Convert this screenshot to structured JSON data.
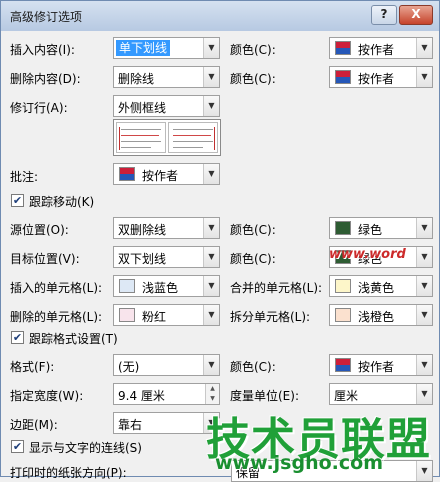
{
  "window": {
    "title": "高级修订选项",
    "help_label": "?",
    "close_label": "X"
  },
  "colors": {
    "author_top": "#cc1f3a",
    "author_bottom": "#2557b8",
    "green": "#2e5c33",
    "light_blue": "#dde8f5",
    "pink": "#f8e4ec",
    "light_orange": "#fbe1cf",
    "selection": "#3399ff"
  },
  "markup": {
    "insert_label": "插入内容(I):",
    "insert_value": "单下划线",
    "insert_color_label": "颜色(C):",
    "insert_color_value": "按作者",
    "delete_label": "删除内容(D):",
    "delete_value": "删除线",
    "delete_color_label": "颜色(C):",
    "delete_color_value": "按作者",
    "changed_lines_label": "修订行(A):",
    "changed_lines_value": "外侧框线",
    "comments_label": "批注:",
    "comments_value": "按作者"
  },
  "moves": {
    "track_label": "跟踪移动(K)",
    "track_checked": true,
    "from_label": "源位置(O):",
    "from_value": "双删除线",
    "from_color_label": "颜色(C):",
    "from_color_value": "绿色",
    "to_label": "目标位置(V):",
    "to_value": "双下划线",
    "to_color_label": "颜色(C):",
    "to_color_value": "绿色"
  },
  "table": {
    "inserted_label": "插入的单元格(L):",
    "inserted_value": "浅蓝色",
    "merged_label": "合并的单元格(L):",
    "merged_value": "浅黄色",
    "deleted_label": "删除的单元格(L):",
    "deleted_value": "粉红",
    "split_label": "拆分单元格(L):",
    "split_value": "浅橙色"
  },
  "formatting": {
    "track_label": "跟踪格式设置(T)",
    "track_checked": true,
    "format_label": "格式(F):",
    "format_value": "(无)",
    "format_color_label": "颜色(C):",
    "format_color_value": "按作者"
  },
  "balloons": {
    "width_label": "指定宽度(W):",
    "width_value": "9.4 厘米",
    "measure_label": "度量单位(E):",
    "measure_value": "厘米",
    "margin_label": "边距(M):",
    "margin_value": "靠右",
    "lines_label": "显示与文字的连线(S)",
    "lines_checked": true,
    "orientation_label": "打印时的纸张方向(P):",
    "orientation_value": "保留"
  },
  "watermark": {
    "cn_text": "技术员联盟",
    "url_text": "www.jsgho.com",
    "small_text": "www.word"
  }
}
